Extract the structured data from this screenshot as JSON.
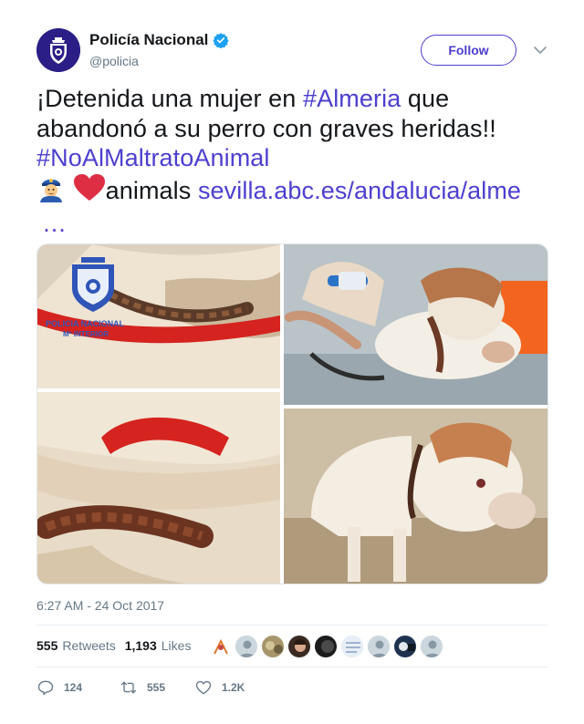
{
  "author": {
    "display_name": "Policía Nacional",
    "handle": "@policia",
    "avatar_icon": "policia-shield-icon",
    "verified": true
  },
  "follow_label": "Follow",
  "tweet": {
    "line1_prefix": "¡Detenida una mujer en ",
    "hashtag1": "#Almeria",
    "line1_suffix": " que",
    "line2": "abandonó a su perro con graves heridas!!",
    "hashtag2": "#NoAlMaltratoAnimal",
    "animals_word": "animals ",
    "link_text": "sevilla.abc.es/andalucia/alme",
    "ellipsis": "…"
  },
  "media": {
    "badge_line1": "POLICIA NACIONAL",
    "badge_line2": "Mº INTERIOR"
  },
  "timestamp": "6:27 AM - 24 Oct 2017",
  "stats": {
    "retweets_count": "555",
    "retweets_label": "Retweets",
    "likes_count": "1,193",
    "likes_label": "Likes"
  },
  "actions": {
    "reply_count": "124",
    "retweet_count": "555",
    "like_count": "1.2K"
  },
  "colors": {
    "link": "#4c3fcf",
    "verified": "#1da1f2",
    "text": "#14171a",
    "muted": "#657786"
  }
}
